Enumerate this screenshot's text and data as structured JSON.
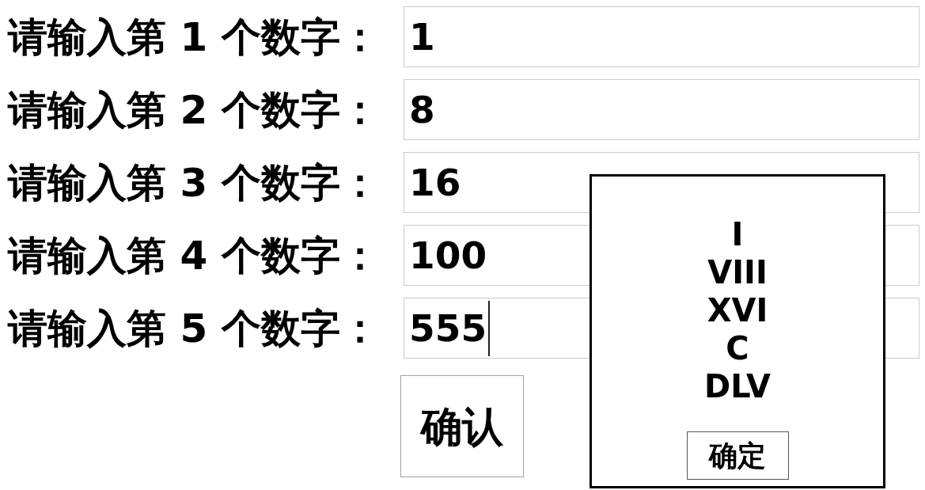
{
  "fields": [
    {
      "label": "请输入第 1 个数字：",
      "value": "1",
      "focused": false
    },
    {
      "label": "请输入第 2 个数字：",
      "value": "8",
      "focused": false
    },
    {
      "label": "请输入第 3 个数字：",
      "value": "16",
      "focused": false
    },
    {
      "label": "请输入第 4 个数字：",
      "value": "100",
      "focused": false
    },
    {
      "label": "请输入第 5 个数字：",
      "value": "555",
      "focused": true
    }
  ],
  "confirm_button": {
    "label": "确认"
  },
  "dialog": {
    "lines": [
      "I",
      "VIII",
      "XVI",
      "C",
      "DLV"
    ],
    "button": {
      "label": "确定"
    }
  }
}
